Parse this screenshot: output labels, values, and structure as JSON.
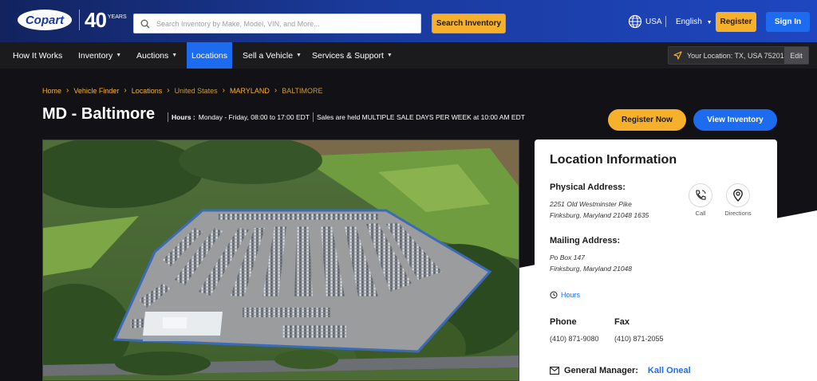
{
  "header": {
    "logo": "Copart",
    "anniversary_number": "40",
    "anniversary_text": "YEARS",
    "search_placeholder": "Search Inventory by Make, Model, VIN, and More...",
    "search_button": "Search Inventory",
    "country": "USA",
    "language": "English",
    "register": "Register",
    "sign_in": "Sign In"
  },
  "nav": {
    "items": [
      {
        "label": "How It Works",
        "caret": false
      },
      {
        "label": "Inventory",
        "caret": true
      },
      {
        "label": "Auctions",
        "caret": true
      },
      {
        "label": "Locations",
        "caret": false,
        "active": true
      },
      {
        "label": "Sell a Vehicle",
        "caret": true
      },
      {
        "label": "Services & Support",
        "caret": true
      }
    ],
    "your_location": "Your Location: TX, USA 75201",
    "edit": "Edit"
  },
  "breadcrumb": [
    "Home",
    "Vehicle Finder",
    "Locations",
    "United States",
    "MARYLAND",
    "BALTIMORE"
  ],
  "page": {
    "title": "MD - Baltimore",
    "hours_label": "Hours :",
    "hours_value": "Monday - Friday, 08:00 to 17:00 EDT",
    "sales_note": "Sales are held MULTIPLE SALE DAYS PER WEEK at 10:00 AM EDT",
    "register_now": "Register Now",
    "view_inventory": "View Inventory"
  },
  "location_info": {
    "heading": "Location Information",
    "physical_label": "Physical Address:",
    "physical_line1": "2251 Old Westminster Pike",
    "physical_line2": "Finksburg, Maryland 21048 1635",
    "mailing_label": "Mailing Address:",
    "mailing_line1": "Po Box 147",
    "mailing_line2": "Finksburg, Maryland 21048",
    "call_label": "Call",
    "directions_label": "Directions",
    "hours_link": "Hours",
    "phone_label": "Phone",
    "phone_value": "(410) 871-9080",
    "fax_label": "Fax",
    "fax_value": "(410) 871-2055",
    "gm_label": "General Manager:",
    "gm_name": "Kall Oneal"
  },
  "colors": {
    "brand_blue": "#1d6cf0",
    "accent_yellow": "#f6b02c",
    "header_navy": "#12235e",
    "nav_dark": "#1b1b1d"
  }
}
